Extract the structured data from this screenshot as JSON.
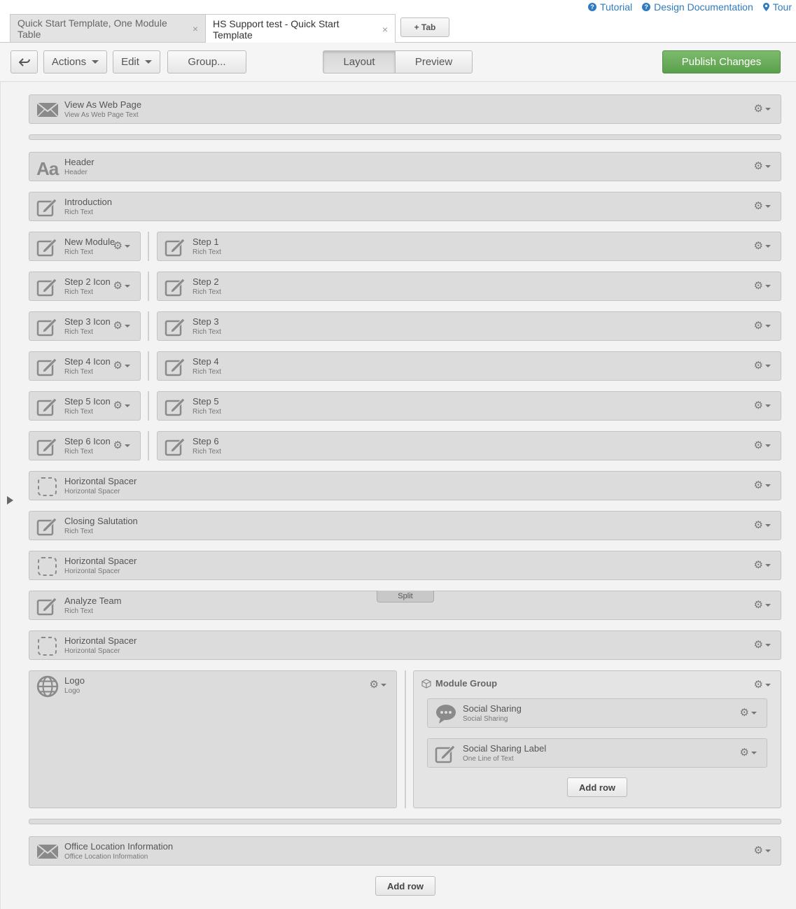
{
  "top_links": [
    {
      "label": "Tutorial",
      "icon": "question-icon"
    },
    {
      "label": "Design Documentation",
      "icon": "question-icon"
    },
    {
      "label": "Tour",
      "icon": "location-pin-icon"
    }
  ],
  "tabs": [
    {
      "label": "Quick Start Template, One Module Table",
      "active": false
    },
    {
      "label": "HS Support test - Quick Start Template",
      "active": true
    }
  ],
  "tab_close": "×",
  "add_tab_label": "+ Tab",
  "toolbar": {
    "actions_label": "Actions",
    "edit_label": "Edit",
    "group_label": "Group...",
    "layout_label": "Layout",
    "preview_label": "Preview",
    "publish_label": "Publish Changes",
    "selected_view": "Layout"
  },
  "modules": {
    "view_web": {
      "title": "View As Web Page",
      "sub": "View As Web Page Text",
      "icon": "envelope-icon"
    },
    "header": {
      "title": "Header",
      "sub": "Header",
      "icon": "text-format-icon"
    },
    "intro": {
      "title": "Introduction",
      "sub": "Rich Text",
      "icon": "edit-icon"
    },
    "new_module": {
      "title": "New Module",
      "sub": "Rich Text",
      "icon": "edit-icon"
    },
    "step1": {
      "title": "Step 1",
      "sub": "Rich Text",
      "icon": "edit-icon"
    },
    "step2_icon": {
      "title": "Step 2 Icon",
      "sub": "Rich Text",
      "icon": "edit-icon"
    },
    "step2": {
      "title": "Step 2",
      "sub": "Rich Text",
      "icon": "edit-icon"
    },
    "step3_icon": {
      "title": "Step 3 Icon",
      "sub": "Rich Text",
      "icon": "edit-icon"
    },
    "step3": {
      "title": "Step 3",
      "sub": "Rich Text",
      "icon": "edit-icon"
    },
    "step4_icon": {
      "title": "Step 4 Icon",
      "sub": "Rich Text",
      "icon": "edit-icon"
    },
    "step4": {
      "title": "Step 4",
      "sub": "Rich Text",
      "icon": "edit-icon"
    },
    "step5_icon": {
      "title": "Step 5 Icon",
      "sub": "Rich Text",
      "icon": "edit-icon"
    },
    "step5": {
      "title": "Step 5",
      "sub": "Rich Text",
      "icon": "edit-icon"
    },
    "step6_icon": {
      "title": "Step 6 Icon",
      "sub": "Rich Text",
      "icon": "edit-icon"
    },
    "step6": {
      "title": "Step 6",
      "sub": "Rich Text",
      "icon": "edit-icon"
    },
    "spacer1": {
      "title": "Horizontal Spacer",
      "sub": "Horizontal Spacer",
      "icon": "dashed-box-icon"
    },
    "closing": {
      "title": "Closing Salutation",
      "sub": "Rich Text",
      "icon": "edit-icon"
    },
    "spacer2": {
      "title": "Horizontal Spacer",
      "sub": "Horizontal Spacer",
      "icon": "dashed-box-icon"
    },
    "analyze": {
      "title": "Analyze Team",
      "sub": "Rich Text",
      "icon": "edit-icon"
    },
    "spacer3": {
      "title": "Horizontal Spacer",
      "sub": "Horizontal Spacer",
      "icon": "dashed-box-icon"
    },
    "logo": {
      "title": "Logo",
      "sub": "Logo",
      "icon": "globe-icon"
    },
    "social": {
      "title": "Social Sharing",
      "sub": "Social Sharing",
      "icon": "speech-bubble-icon"
    },
    "social_label": {
      "title": "Social Sharing Label",
      "sub": "One Line of Text",
      "icon": "edit-icon"
    },
    "office": {
      "title": "Office Location Information",
      "sub": "Office Location Information",
      "icon": "envelope-icon"
    }
  },
  "module_group_label": "Module Group",
  "split_label": "Split",
  "add_row_label": "Add row"
}
